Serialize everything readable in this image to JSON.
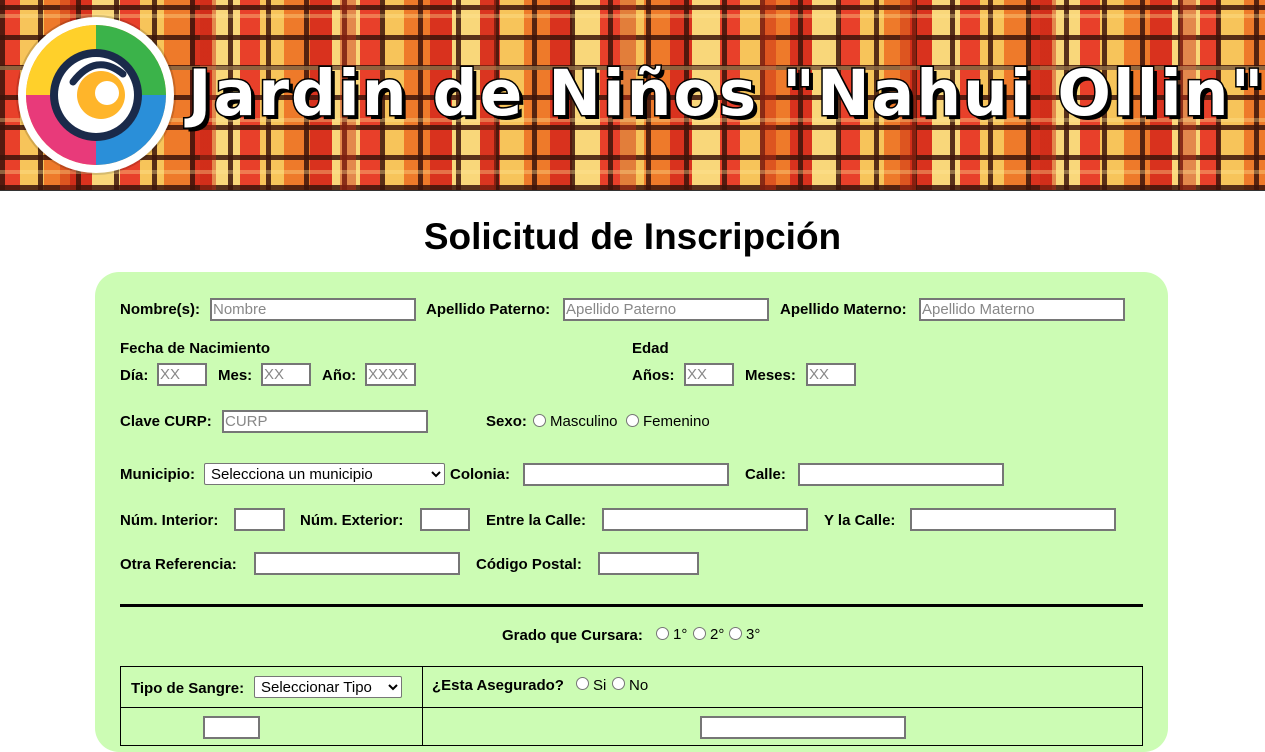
{
  "header": {
    "title": "Jardin de Niños \"Nahui Ollin\"",
    "logo_icon": "swirl-logo-icon"
  },
  "page_title": "Solicitud de Inscripción",
  "form": {
    "nombre": {
      "label": "Nombre(s):",
      "placeholder": "Nombre"
    },
    "apellido_paterno": {
      "label": "Apellido Paterno:",
      "placeholder": "Apellido Paterno"
    },
    "apellido_materno": {
      "label": "Apellido Materno:",
      "placeholder": "Apellido Materno"
    },
    "fecha_nacimiento": {
      "label": "Fecha de Nacimiento",
      "dia": {
        "label": "Día:",
        "placeholder": "XX"
      },
      "mes": {
        "label": "Mes:",
        "placeholder": "XX"
      },
      "anio": {
        "label": "Año:",
        "placeholder": "XXXX"
      }
    },
    "edad": {
      "label": "Edad",
      "anios": {
        "label": "Años:",
        "placeholder": "XX"
      },
      "meses": {
        "label": "Meses:",
        "placeholder": "XX"
      }
    },
    "curp": {
      "label": "Clave CURP:",
      "placeholder": "CURP"
    },
    "sexo": {
      "label": "Sexo:",
      "options": [
        "Masculino",
        "Femenino"
      ]
    },
    "municipio": {
      "label": "Municipio:",
      "selected": "Selecciona un municipio"
    },
    "colonia": {
      "label": "Colonia:"
    },
    "calle": {
      "label": "Calle:"
    },
    "num_interior": {
      "label": "Núm. Interior:"
    },
    "num_exterior": {
      "label": "Núm. Exterior:"
    },
    "entre_calle": {
      "label": "Entre la Calle:"
    },
    "y_la_calle": {
      "label": "Y la Calle:"
    },
    "otra_referencia": {
      "label": "Otra Referencia:"
    },
    "codigo_postal": {
      "label": "Código Postal:"
    },
    "grado": {
      "label": "Grado que Cursara:",
      "options": [
        "1°",
        "2°",
        "3°"
      ]
    },
    "tipo_sangre": {
      "label": "Tipo de Sangre:",
      "selected": "Seleccionar Tipo"
    },
    "asegurado": {
      "label": "¿Esta Asegurado?",
      "options": [
        "Si",
        "No"
      ]
    }
  },
  "colors": {
    "panel_bg": "#ccfcb4",
    "input_border": "#767676",
    "banner_base": "#f2a03c"
  }
}
